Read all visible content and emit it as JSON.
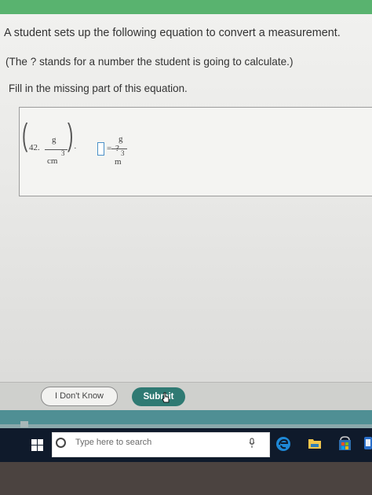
{
  "question": {
    "line1": "A student sets up the following equation to convert a measurement.",
    "line2": "(The ? stands for a number the student is going to calculate.)",
    "line3": "Fill in the missing part of this equation."
  },
  "equation": {
    "coefficient": "42.",
    "left_numerator": "g",
    "left_exponent": "3",
    "left_denominator": "cm",
    "dot": "·",
    "equals": "=",
    "question_mark": "?",
    "right_numerator": "g",
    "right_exponent": "3",
    "right_denominator": "m"
  },
  "buttons": {
    "dont_know": "I Don't Know",
    "submit": "Submit"
  },
  "taskbar": {
    "search_placeholder": "Type here to search"
  },
  "colors": {
    "brand_green": "#59b36f",
    "submit_teal": "#2f7a73",
    "taskbar": "#0f1a2b",
    "edge_blue": "#1e88d6"
  },
  "icons": [
    "windows-icon",
    "search-icon",
    "mic-icon",
    "edge-icon",
    "folder-icon",
    "store-icon"
  ]
}
